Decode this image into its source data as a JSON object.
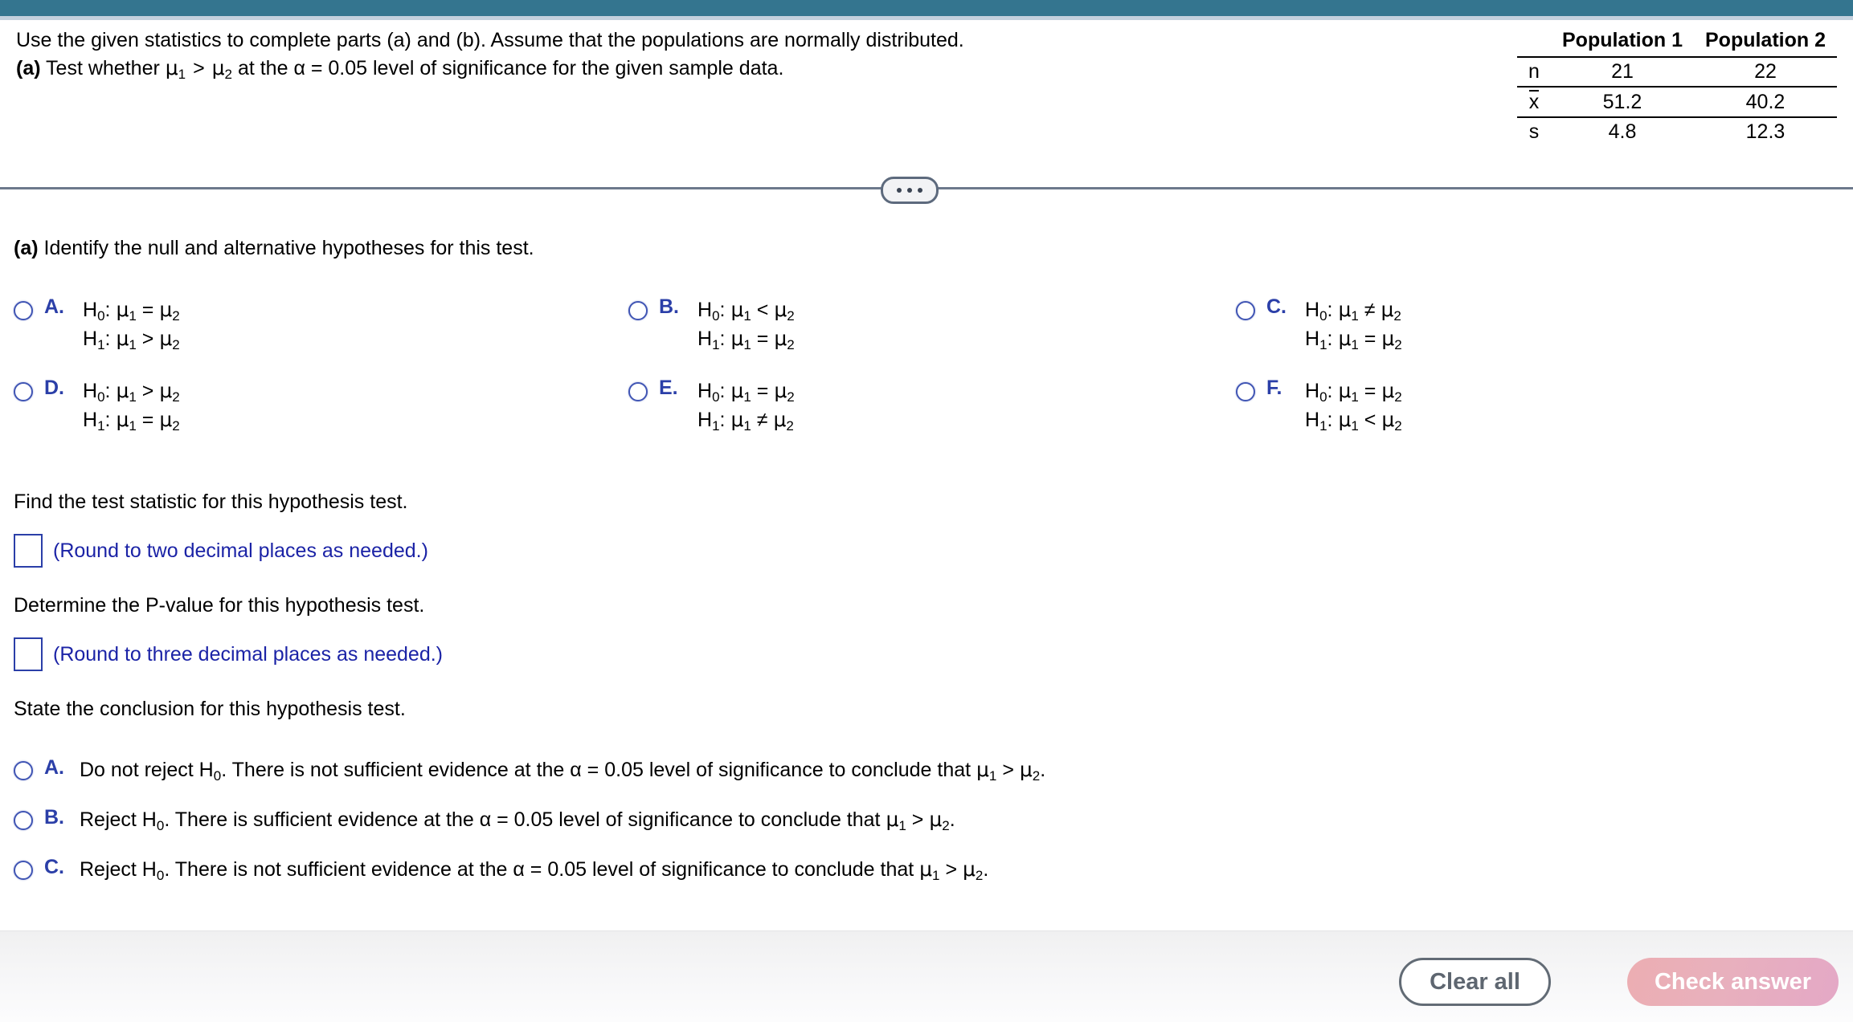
{
  "header": {
    "bar_color": "#34758f",
    "underline_color": "#c3d0dd"
  },
  "stem": {
    "line1": "Use the given statistics to complete parts (a) and (b). Assume that the populations are normally distributed.",
    "line2_prefix": "(a)",
    "line2_a": " Test whether ",
    "line2_mu1": "μ",
    "line2_sub1": "1",
    "line2_gt": " > ",
    "line2_mu2": "μ",
    "line2_sub2": "2",
    "line2_b": " at the α = 0.05 level of significance for the given sample data."
  },
  "stats_table": {
    "columns": [
      "Population 1",
      "Population 2"
    ],
    "rows": [
      {
        "label": "n",
        "overline": false,
        "values": [
          "21",
          "22"
        ]
      },
      {
        "label": "x",
        "overline": true,
        "values": [
          "51.2",
          "40.2"
        ]
      },
      {
        "label": "s",
        "overline": false,
        "values": [
          "4.8",
          "12.3"
        ]
      }
    ]
  },
  "divider": {
    "ellipsis_dots": 3
  },
  "part_a": {
    "prompt_bold": "(a)",
    "prompt_rest": " Identify the null and alternative hypotheses for this test."
  },
  "hypothesis_choices": [
    {
      "letter": "A.",
      "h0": "H₀ : μ₁ = μ₂",
      "h1": "H₁ : μ₁ > μ₂",
      "h0_parts": {
        "H": "H",
        "Hsub": "0",
        "mu": "μ",
        "mus1": "1",
        "op": "=",
        "mu2": "μ",
        "mus2": "2"
      },
      "h1_parts": {
        "H": "H",
        "Hsub": "1",
        "mu": "μ",
        "mus1": "1",
        "op": ">",
        "mu2": "μ",
        "mus2": "2"
      }
    },
    {
      "letter": "D.",
      "h0": "H₀ : μ₁ > μ₂",
      "h1": "H₁ : μ₁ = μ₂",
      "h0_parts": {
        "H": "H",
        "Hsub": "0",
        "mu": "μ",
        "mus1": "1",
        "op": ">",
        "mu2": "μ",
        "mus2": "2"
      },
      "h1_parts": {
        "H": "H",
        "Hsub": "1",
        "mu": "μ",
        "mus1": "1",
        "op": "=",
        "mu2": "μ",
        "mus2": "2"
      }
    },
    {
      "letter": "B.",
      "h0": "H₀ : μ₁ < μ₂",
      "h1": "H₁ : μ₁ = μ₂",
      "h0_parts": {
        "H": "H",
        "Hsub": "0",
        "mu": "μ",
        "mus1": "1",
        "op": "<",
        "mu2": "μ",
        "mus2": "2"
      },
      "h1_parts": {
        "H": "H",
        "Hsub": "1",
        "mu": "μ",
        "mus1": "1",
        "op": "=",
        "mu2": "μ",
        "mus2": "2"
      }
    },
    {
      "letter": "E.",
      "h0": "H₀ : μ₁ = μ₂",
      "h1": "H₁ : μ₁ ≠ μ₂",
      "h0_parts": {
        "H": "H",
        "Hsub": "0",
        "mu": "μ",
        "mus1": "1",
        "op": "=",
        "mu2": "μ",
        "mus2": "2"
      },
      "h1_parts": {
        "H": "H",
        "Hsub": "1",
        "mu": "μ",
        "mus1": "1",
        "op": "≠",
        "mu2": "μ",
        "mus2": "2"
      }
    },
    {
      "letter": "C.",
      "h0": "H₀ : μ₁ ≠ μ₂",
      "h1": "H₁ : μ₁ = μ₂",
      "h0_parts": {
        "H": "H",
        "Hsub": "0",
        "mu": "μ",
        "mus1": "1",
        "op": "≠",
        "mu2": "μ",
        "mus2": "2"
      },
      "h1_parts": {
        "H": "H",
        "Hsub": "1",
        "mu": "μ",
        "mus1": "1",
        "op": "=",
        "mu2": "μ",
        "mus2": "2"
      }
    },
    {
      "letter": "F.",
      "h0": "H₀ : μ₁ = μ₂",
      "h1": "H₁ : μ₁ < μ₂",
      "h0_parts": {
        "H": "H",
        "Hsub": "0",
        "mu": "μ",
        "mus1": "1",
        "op": "=",
        "mu2": "μ",
        "mus2": "2"
      },
      "h1_parts": {
        "H": "H",
        "Hsub": "1",
        "mu": "μ",
        "mus1": "1",
        "op": "<",
        "mu2": "μ",
        "mus2": "2"
      }
    }
  ],
  "test_statistic": {
    "prompt": "Find the test statistic for this hypothesis test.",
    "input_value": "",
    "hint": "(Round to two decimal places as needed.)"
  },
  "p_value": {
    "prompt": "Determine the P-value for this hypothesis test.",
    "input_value": "",
    "hint": "(Round to three decimal places as needed.)"
  },
  "conclusion": {
    "prompt": "State the conclusion for this hypothesis test.",
    "choices": [
      {
        "letter": "A.",
        "part1": "Do not reject H",
        "sub": "0",
        "part2": ". There is not sufficient evidence at the α = 0.05 level of significance to conclude that ",
        "mu1": "μ",
        "mus1": "1",
        "op": " > ",
        "mu2": "μ",
        "mus2": "2",
        "end": "."
      },
      {
        "letter": "B.",
        "part1": "Reject H",
        "sub": "0",
        "part2": ". There is sufficient evidence at the α = 0.05 level of significance to conclude that ",
        "mu1": "μ",
        "mus1": "1",
        "op": " > ",
        "mu2": "μ",
        "mus2": "2",
        "end": "."
      },
      {
        "letter": "C.",
        "part1": "Reject H",
        "sub": "0",
        "part2": ". There is not sufficient evidence at the α = 0.05 level of significance to conclude that ",
        "mu1": "μ",
        "mus1": "1",
        "op": " > ",
        "mu2": "μ",
        "mus2": "2",
        "end": "."
      }
    ]
  },
  "footer": {
    "clear_all_label": "Clear all",
    "check_answer_label": "Check answer",
    "check_answer_color": "#e8b0bd"
  }
}
